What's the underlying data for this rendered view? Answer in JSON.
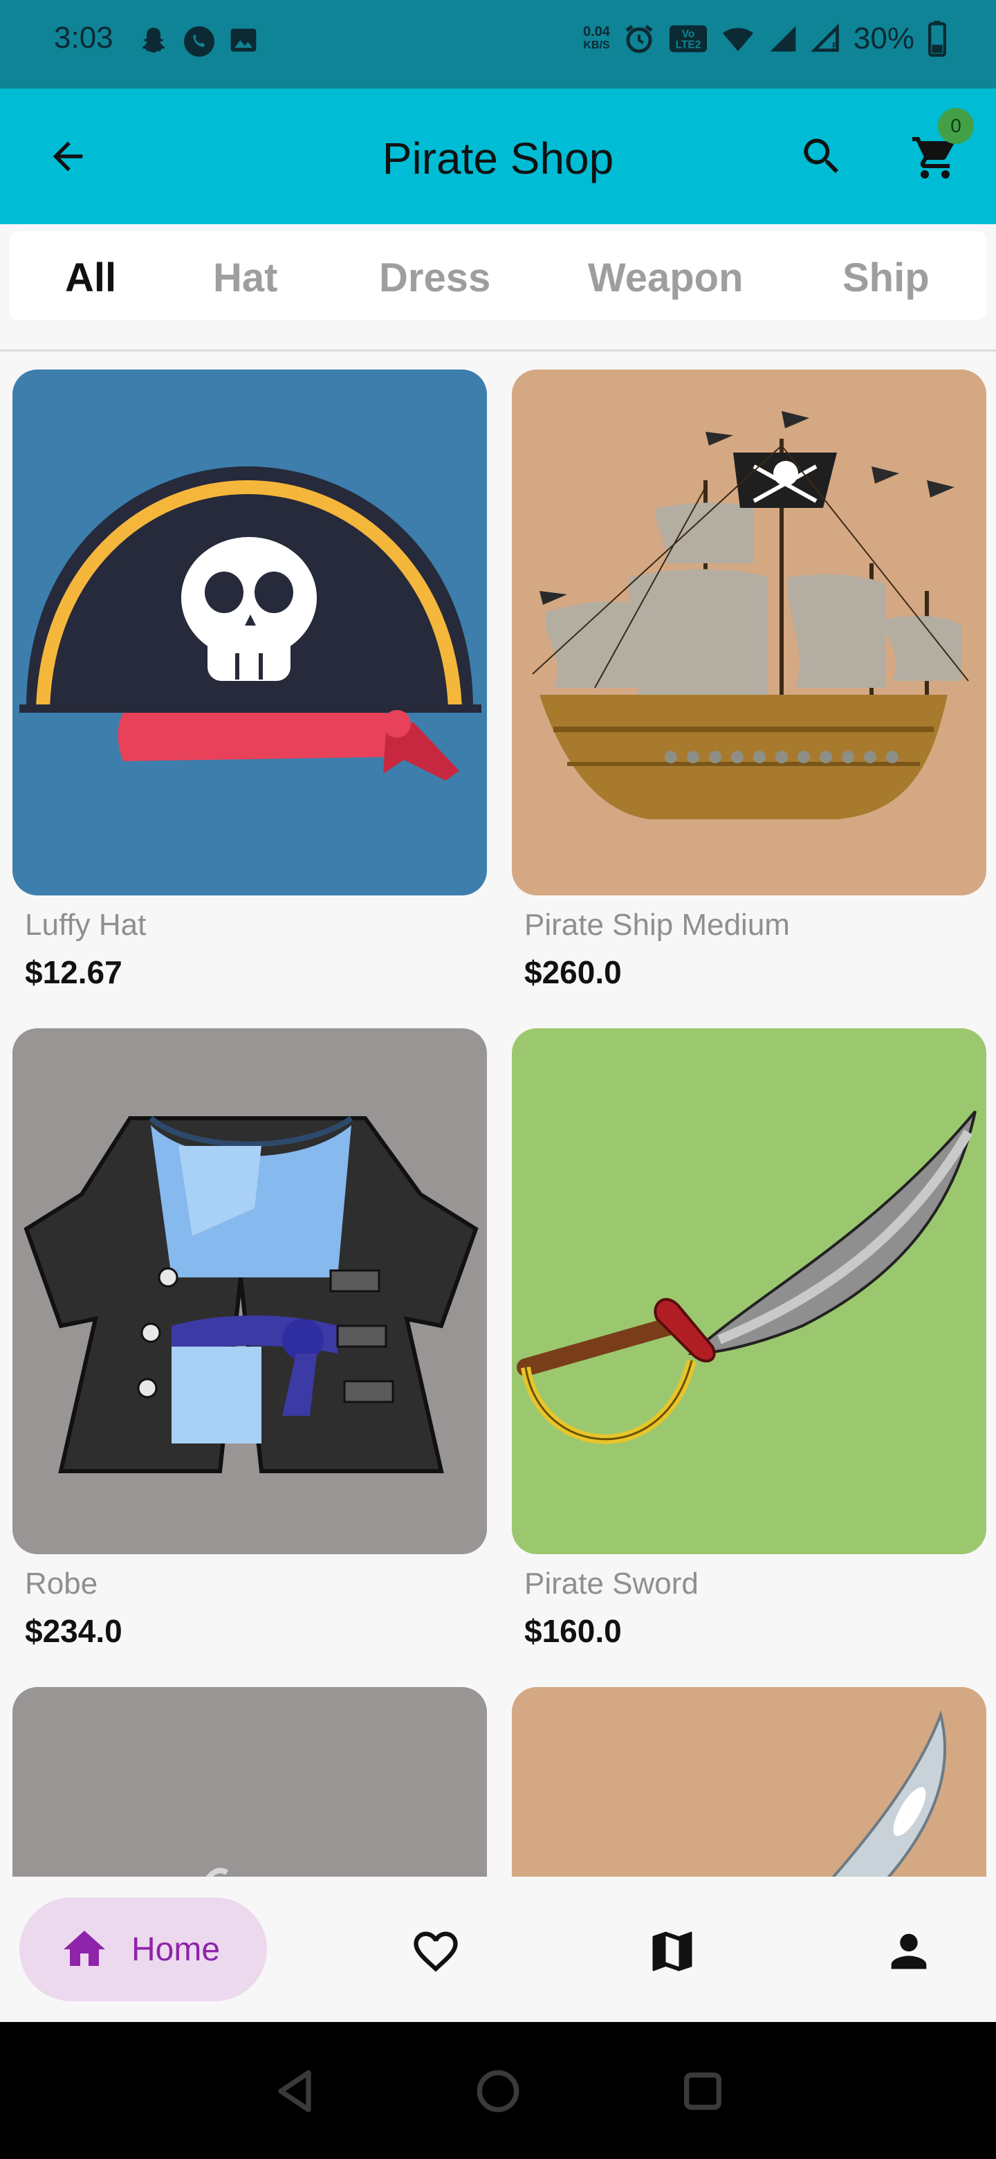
{
  "status_bar": {
    "time": "3:03",
    "net_speed_value": "0.04",
    "net_speed_unit": "KB/S",
    "battery": "30%",
    "left_icons": [
      "snapchat-icon",
      "phone-icon",
      "image-icon"
    ],
    "right_icons": [
      "alarm-icon",
      "volte-icon",
      "wifi-icon",
      "signal-icon",
      "signal-r-icon",
      "battery-icon"
    ]
  },
  "app_bar": {
    "title": "Pirate Shop",
    "back_icon": "arrow-back-icon",
    "search_icon": "search-icon",
    "cart_icon": "cart-icon",
    "cart_count": "0",
    "background": "#00bcd4",
    "badge_color": "#43a047"
  },
  "tabs": [
    {
      "label": "All",
      "active": true
    },
    {
      "label": "Hat",
      "active": false
    },
    {
      "label": "Dress",
      "active": false
    },
    {
      "label": "Weapon",
      "active": false
    },
    {
      "label": "Ship",
      "active": false
    }
  ],
  "products": [
    {
      "name": "Luffy Hat",
      "price": "$12.67",
      "bg": "#3d7eac",
      "image": "pirate-hat-image"
    },
    {
      "name": "Pirate Ship Medium",
      "price": "$260.0",
      "bg": "#d4a883",
      "image": "pirate-ship-image"
    },
    {
      "name": "Robe",
      "price": "$234.0",
      "bg": "#999595",
      "image": "pirate-coat-image"
    },
    {
      "name": "Pirate Sword",
      "price": "$160.0",
      "bg": "#9bc86e",
      "image": "pirate-sword-image"
    },
    {
      "name": "",
      "price": "",
      "bg": "#999595",
      "image": "partial-item-image"
    },
    {
      "name": "",
      "price": "",
      "bg": "#d4a883",
      "image": "partial-blade-image"
    }
  ],
  "bottom_nav": {
    "home_label": "Home",
    "home_icon": "home-icon",
    "favorites_icon": "heart-icon",
    "map_icon": "map-icon",
    "profile_icon": "person-icon",
    "active_color": "#8e24aa",
    "active_bg": "#ecd9ee"
  },
  "system_nav": {
    "back_icon": "triangle-back-icon",
    "home_icon": "circle-home-icon",
    "recents_icon": "square-recents-icon"
  }
}
